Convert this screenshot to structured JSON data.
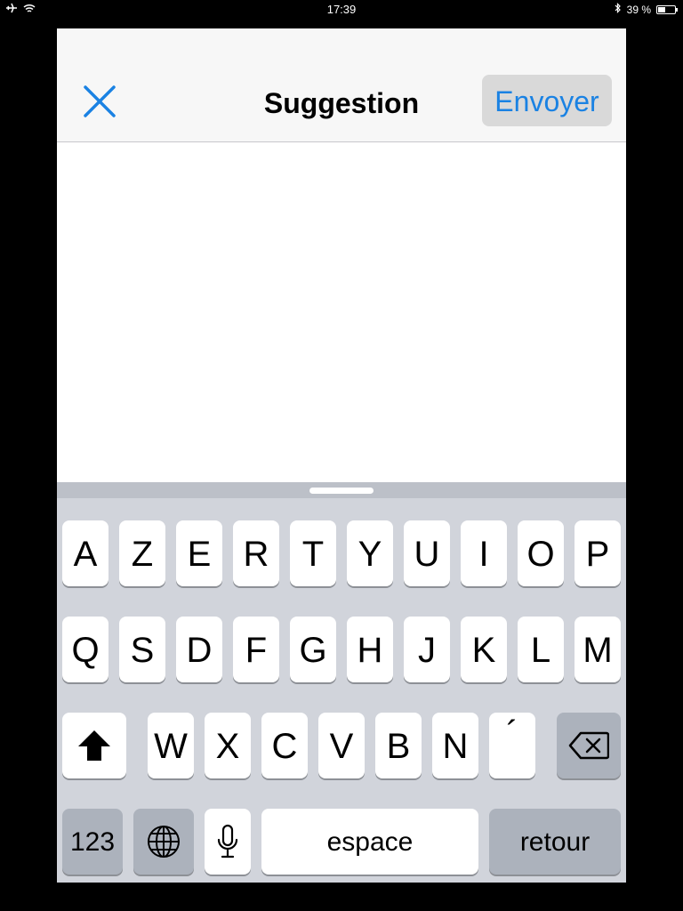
{
  "status": {
    "time": "17:39",
    "battery_text": "39 %"
  },
  "navbar": {
    "title": "Suggestion",
    "send_label": "Envoyer"
  },
  "keyboard": {
    "row1": [
      "A",
      "Z",
      "E",
      "R",
      "T",
      "Y",
      "U",
      "I",
      "O",
      "P"
    ],
    "row2": [
      "Q",
      "S",
      "D",
      "F",
      "G",
      "H",
      "J",
      "K",
      "L",
      "M"
    ],
    "row3": [
      "W",
      "X",
      "C",
      "V",
      "B",
      "N",
      "´"
    ],
    "numbers_label": "123",
    "space_label": "espace",
    "return_label": "retour"
  },
  "colors": {
    "accent": "#1a82e3",
    "keyboard_bg": "#d1d4db"
  }
}
